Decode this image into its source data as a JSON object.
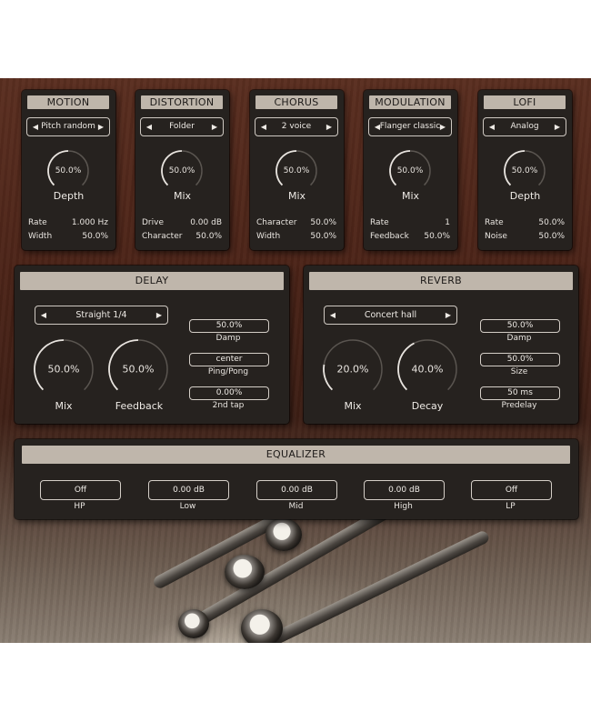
{
  "motion": {
    "title": "MOTION",
    "selector": "Pitch random",
    "knob_value": "50.0%",
    "knob_level": 0.5,
    "knob_label": "Depth",
    "params": [
      {
        "name": "Rate",
        "value": "1.000 Hz"
      },
      {
        "name": "Width",
        "value": "50.0%"
      }
    ]
  },
  "distortion": {
    "title": "DISTORTION",
    "selector": "Folder",
    "knob_value": "50.0%",
    "knob_level": 0.5,
    "knob_label": "Mix",
    "params": [
      {
        "name": "Drive",
        "value": "0.00 dB"
      },
      {
        "name": "Character",
        "value": "50.0%"
      }
    ]
  },
  "chorus": {
    "title": "CHORUS",
    "selector": "2 voice",
    "knob_value": "50.0%",
    "knob_level": 0.5,
    "knob_label": "Mix",
    "params": [
      {
        "name": "Character",
        "value": "50.0%"
      },
      {
        "name": "Width",
        "value": "50.0%"
      }
    ]
  },
  "modulation": {
    "title": "MODULATION",
    "selector": "Flanger classic",
    "knob_value": "50.0%",
    "knob_level": 0.5,
    "knob_label": "Mix",
    "params": [
      {
        "name": "Rate",
        "value": "1"
      },
      {
        "name": "Feedback",
        "value": "50.0%"
      }
    ]
  },
  "lofi": {
    "title": "LOFI",
    "selector": "Analog",
    "knob_value": "50.0%",
    "knob_level": 0.5,
    "knob_label": "Depth",
    "params": [
      {
        "name": "Rate",
        "value": "50.0%"
      },
      {
        "name": "Noise",
        "value": "50.0%"
      }
    ]
  },
  "delay": {
    "title": "DELAY",
    "selector": "Straight 1/4",
    "mix": {
      "value": "50.0%",
      "level": 0.5,
      "label": "Mix"
    },
    "feedback": {
      "value": "50.0%",
      "level": 0.5,
      "label": "Feedback"
    },
    "boxes": [
      {
        "value": "50.0%",
        "label": "Damp"
      },
      {
        "value": "center",
        "label": "Ping/Pong"
      },
      {
        "value": "0.00%",
        "label": "2nd tap"
      }
    ]
  },
  "reverb": {
    "title": "REVERB",
    "selector": "Concert hall",
    "mix": {
      "value": "20.0%",
      "level": 0.2,
      "label": "Mix"
    },
    "decay": {
      "value": "40.0%",
      "level": 0.4,
      "label": "Decay"
    },
    "boxes": [
      {
        "value": "50.0%",
        "label": "Damp"
      },
      {
        "value": "50.0%",
        "label": "Size"
      },
      {
        "value": "50 ms",
        "label": "Predelay"
      }
    ]
  },
  "equalizer": {
    "title": "EQUALIZER",
    "bands": [
      {
        "value": "Off",
        "label": "HP"
      },
      {
        "value": "0.00 dB",
        "label": "Low"
      },
      {
        "value": "0.00 dB",
        "label": "Mid"
      },
      {
        "value": "0.00 dB",
        "label": "High"
      },
      {
        "value": "Off",
        "label": "LP"
      }
    ]
  },
  "colors": {
    "arc": "#e8e4df",
    "track": "#5a5550",
    "title_bg": "#bfb6ab",
    "panel": "#26221f"
  }
}
